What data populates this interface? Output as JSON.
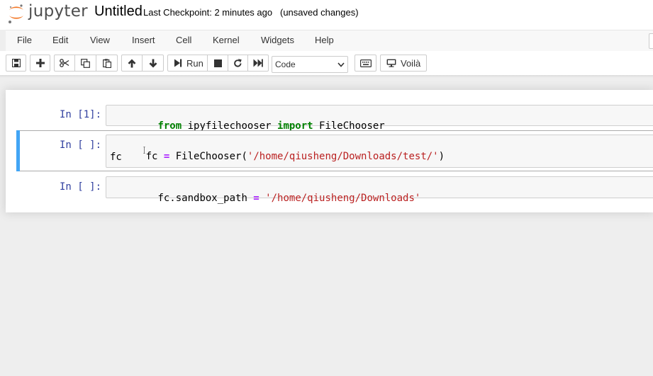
{
  "header": {
    "logo_text": "jupyter",
    "title": "Untitled",
    "checkpoint": "Last Checkpoint: 2 minutes ago",
    "status": "(unsaved changes)"
  },
  "menu": {
    "items": [
      "File",
      "Edit",
      "View",
      "Insert",
      "Cell",
      "Kernel",
      "Widgets",
      "Help"
    ]
  },
  "toolbar": {
    "buttons": [
      {
        "name": "save-button",
        "icon": "floppy-icon"
      },
      {
        "name": "insert-cell-button",
        "icon": "plus-icon"
      },
      {
        "name": "cut-button",
        "icon": "scissors-icon"
      },
      {
        "name": "copy-button",
        "icon": "copy-icon"
      },
      {
        "name": "paste-button",
        "icon": "clipboard-icon"
      },
      {
        "name": "move-up-button",
        "icon": "arrow-up-icon"
      },
      {
        "name": "move-down-button",
        "icon": "arrow-down-icon"
      },
      {
        "name": "run-button",
        "icon": "step-forward-icon"
      },
      {
        "name": "interrupt-button",
        "icon": "stop-icon"
      },
      {
        "name": "restart-button",
        "icon": "refresh-icon"
      },
      {
        "name": "restart-run-all-button",
        "icon": "fast-forward-icon"
      },
      {
        "name": "command-palette-button",
        "icon": "keyboard-icon"
      },
      {
        "name": "voila-button",
        "icon": "desktop-icon"
      }
    ],
    "run_label": "Run",
    "cell_type": "Code",
    "voila_label": "Voilà"
  },
  "cells": [
    {
      "prompt": "In [1]:",
      "tokens": [
        {
          "t": "from",
          "c": "kw"
        },
        {
          "t": " ipyfilechooser ",
          "c": ""
        },
        {
          "t": "import",
          "c": "kw"
        },
        {
          "t": " FileChooser",
          "c": ""
        }
      ]
    },
    {
      "prompt": "In [ ]:",
      "selected": true,
      "line1": [
        {
          "t": "fc ",
          "c": ""
        },
        {
          "t": "=",
          "c": "op"
        },
        {
          "t": " FileChooser(",
          "c": ""
        },
        {
          "t": "'/home/qiusheng/Downloads/test/'",
          "c": "str"
        },
        {
          "t": ")",
          "c": ""
        }
      ],
      "line2": "fc"
    },
    {
      "prompt": "In [ ]:",
      "tokens": [
        {
          "t": "fc.sandbox_path ",
          "c": ""
        },
        {
          "t": "=",
          "c": "op"
        },
        {
          "t": " ",
          "c": ""
        },
        {
          "t": "'/home/qiusheng/Downloads'",
          "c": "str"
        }
      ]
    }
  ],
  "colors": {
    "accent": "#42a5f5",
    "prompt": "#303f9f",
    "keyword": "#008000",
    "operator": "#aa22ff",
    "string": "#ba2121",
    "logo_orange": "#f37726"
  }
}
